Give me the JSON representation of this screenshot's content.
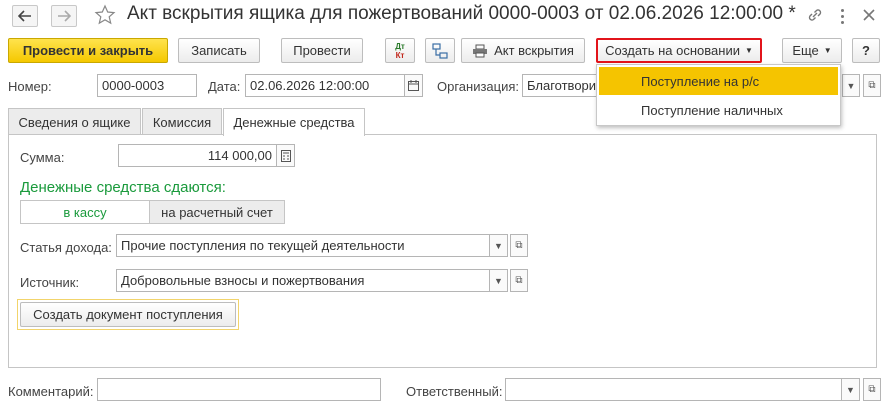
{
  "window": {
    "title": "Акт вскрытия ящика для пожертвований 0000-0003 от 02.06.2026 12:00:00 *",
    "back_icon": "arrow-left-icon",
    "forward_icon": "arrow-right-icon",
    "favorite_icon": "star-icon",
    "link_icon": "link-icon",
    "menu_icon": "more-vertical-icon",
    "close_icon": "close-icon"
  },
  "toolbar": {
    "post_close_label": "Провести и закрыть",
    "save_label": "Записать",
    "post_label": "Провести",
    "dtkt_top": "Дт",
    "dtkt_bottom": "Кт",
    "print_label": "Акт вскрытия",
    "create_based_label": "Создать на основании",
    "more_label": "Еще",
    "help_label": "?"
  },
  "header": {
    "number_label": "Номер:",
    "number_value": "0000-0003",
    "date_label": "Дата:",
    "date_value": "02.06.2026 12:00:00",
    "org_label": "Организация:",
    "org_value": "Благотвори"
  },
  "tabs": [
    {
      "label": "Сведения о ящике"
    },
    {
      "label": "Комиссия"
    },
    {
      "label": "Денежные средства"
    }
  ],
  "money": {
    "sum_label": "Сумма:",
    "sum_value": "114 000,00",
    "heading": "Денежные средства сдаются:",
    "heading_color": "#1a9a3c",
    "option_cash": "в кассу",
    "option_account": "на расчетный счет",
    "income_label": "Статья дохода:",
    "income_value": "Прочие поступления по текущей деятельности",
    "source_label": "Источник:",
    "source_value": "Добровольные взносы и пожертвования",
    "create_doc_label": "Создать документ поступления"
  },
  "footer": {
    "comment_label": "Комментарий:",
    "comment_value": "",
    "responsible_label": "Ответственный:",
    "responsible_value": ""
  },
  "dropdown_menu": {
    "items": [
      {
        "label": "Поступление на р/с"
      },
      {
        "label": "Поступление наличных"
      }
    ]
  },
  "colors": {
    "accent_yellow": "#f5c400",
    "highlight_red": "#e2141b"
  }
}
